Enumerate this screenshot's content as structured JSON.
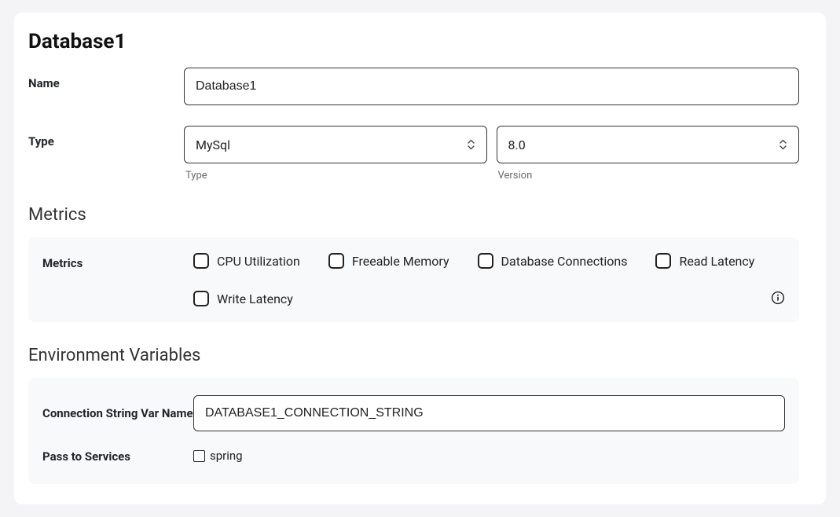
{
  "title": "Database1",
  "fields": {
    "name_label": "Name",
    "name_value": "Database1",
    "type_label": "Type",
    "type_value": "MySql",
    "type_sublabel": "Type",
    "version_value": "8.0",
    "version_sublabel": "Version"
  },
  "metrics": {
    "section_title": "Metrics",
    "label": "Metrics",
    "items": [
      "CPU Utilization",
      "Freeable Memory",
      "Database Connections",
      "Read Latency",
      "Write Latency"
    ]
  },
  "env": {
    "section_title": "Environment Variables",
    "conn_label": "Connection String Var Name",
    "conn_value": "DATABASE1_CONNECTION_STRING",
    "pass_label": "Pass to Services",
    "services": [
      "spring"
    ]
  }
}
